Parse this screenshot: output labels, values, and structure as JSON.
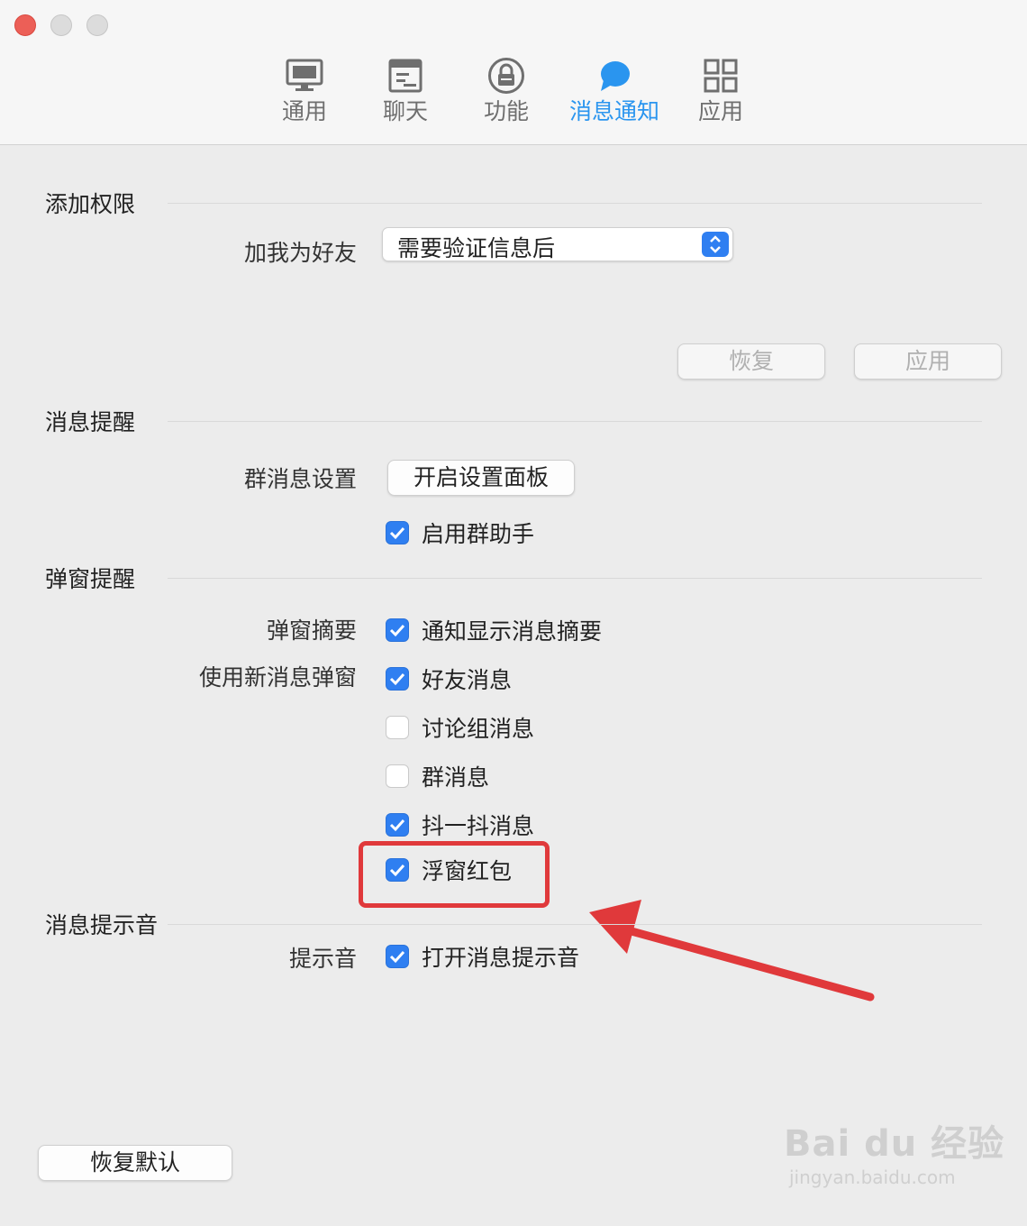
{
  "toolbar": {
    "tabs": [
      {
        "label": "通用",
        "icon": "monitor-icon"
      },
      {
        "label": "聊天",
        "icon": "chat-window-icon"
      },
      {
        "label": "功能",
        "icon": "lock-icon"
      },
      {
        "label": "消息通知",
        "icon": "speech-bubble-icon"
      },
      {
        "label": "应用",
        "icon": "grid-icon"
      }
    ],
    "active_tab": "消息通知",
    "accent_color": "#2a95ef"
  },
  "add_permission": {
    "title": "添加权限",
    "add_friend_label": "加我为好友",
    "add_friend_value": "需要验证信息后",
    "restore_button": "恢复",
    "apply_button": "应用"
  },
  "message_reminder": {
    "title": "消息提醒",
    "group_settings_label": "群消息设置",
    "open_panel_button": "开启设置面板",
    "enable_group_assistant": {
      "label": "启用群助手",
      "checked": true
    }
  },
  "popup_reminder": {
    "title": "弹窗提醒",
    "summary_label": "弹窗摘要",
    "summary_option": {
      "label": "通知显示消息摘要",
      "checked": true
    },
    "new_popup_label": "使用新消息弹窗",
    "options": [
      {
        "label": "好友消息",
        "checked": true
      },
      {
        "label": "讨论组消息",
        "checked": false
      },
      {
        "label": "群消息",
        "checked": false
      },
      {
        "label": "抖一抖消息",
        "checked": true
      },
      {
        "label": "浮窗红包",
        "checked": true
      }
    ]
  },
  "sound": {
    "title": "消息提示音",
    "label": "提示音",
    "option": {
      "label": "打开消息提示音",
      "checked": true
    }
  },
  "footer": {
    "restore_defaults_button": "恢复默认"
  },
  "watermark": {
    "brand": "Bai du 经验",
    "url": "jingyan.baidu.com"
  },
  "annotation_color": "#e0393b"
}
